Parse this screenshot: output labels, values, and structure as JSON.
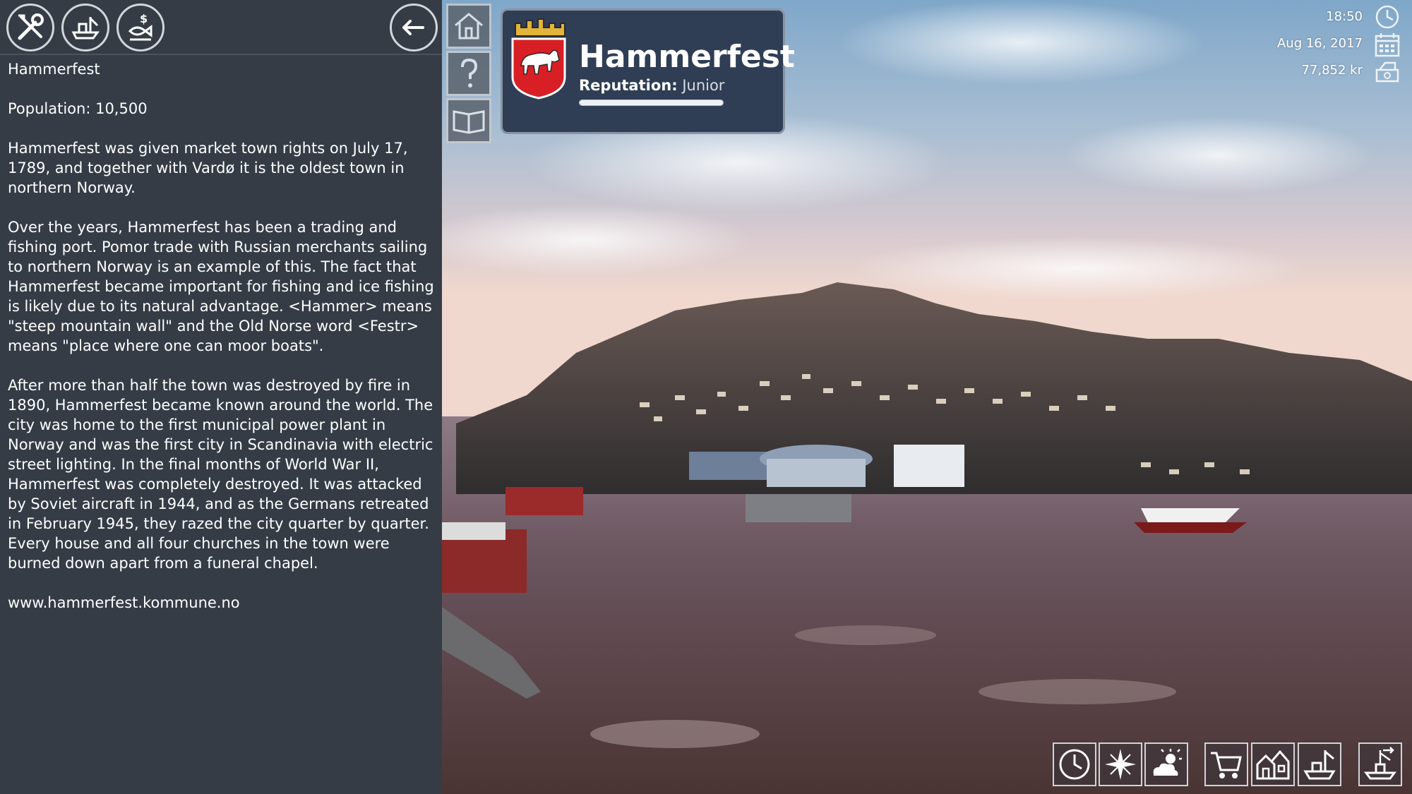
{
  "panel": {
    "toolbar": {
      "tools_icon": "tools-icon",
      "fishing_boat_icon": "fishing-boat-icon",
      "market_icon": "fish-market-icon",
      "back_icon": "back-arrow-icon"
    },
    "town_title": "Hammerfest",
    "population": "Population: 10,500",
    "paragraphs": [
      "Hammerfest was given market town rights on July 17, 1789, and together with Vardø it is the oldest town in northern Norway.",
      "Over the years, Hammerfest has been a trading and fishing port. Pomor trade with Russian merchants sailing to northern Norway is an example of this. The fact that Hammerfest became important for fishing and ice fishing is likely due to its natural advantage. <Hammer> means \"steep mountain wall\" and the Old Norse word <Festr> means \"place where one can moor boats\".",
      "After more than half the town was destroyed by fire in 1890, Hammerfest became known around the world. The city was home to the first municipal power plant in Norway and was the first city in Scandinavia with electric street lighting. In the final months of World War II, Hammerfest was completely destroyed. It was attacked by Soviet aircraft in 1944, and as the Germans retreated in February 1945, they razed the city quarter by quarter. Every house and all four churches in the town were burned down apart from a funeral chapel."
    ],
    "website": "www.hammerfest.kommune.no"
  },
  "side_nav": {
    "home_icon": "home-icon",
    "help_icon": "help-icon",
    "book_icon": "book-icon"
  },
  "town_card": {
    "name": "Hammerfest",
    "reputation_label": "Reputation:",
    "reputation_value": "Junior",
    "reputation_progress": 1.0,
    "crest_icon": "polar-bear-crest-icon"
  },
  "status": {
    "time": "18:50",
    "date": "Aug 16, 2017",
    "money": "77,852 kr",
    "clock_icon": "clock-icon",
    "calendar_icon": "calendar-icon",
    "money_icon": "money-icon"
  },
  "bottom_toolbar": [
    {
      "name": "time-button",
      "icon": "clock-icon"
    },
    {
      "name": "compass-button",
      "icon": "compass-icon"
    },
    {
      "name": "weather-button",
      "icon": "weather-icon"
    },
    {
      "name": "shop-button",
      "icon": "shopping-cart-icon"
    },
    {
      "name": "buildings-button",
      "icon": "buildings-icon"
    },
    {
      "name": "harbor-button",
      "icon": "harbor-icon"
    },
    {
      "name": "sail-button",
      "icon": "sail-icon"
    }
  ],
  "colors": {
    "panel_bg": "#353c46",
    "card_bg": "#2f3e55",
    "crest_red": "#d91f26"
  }
}
